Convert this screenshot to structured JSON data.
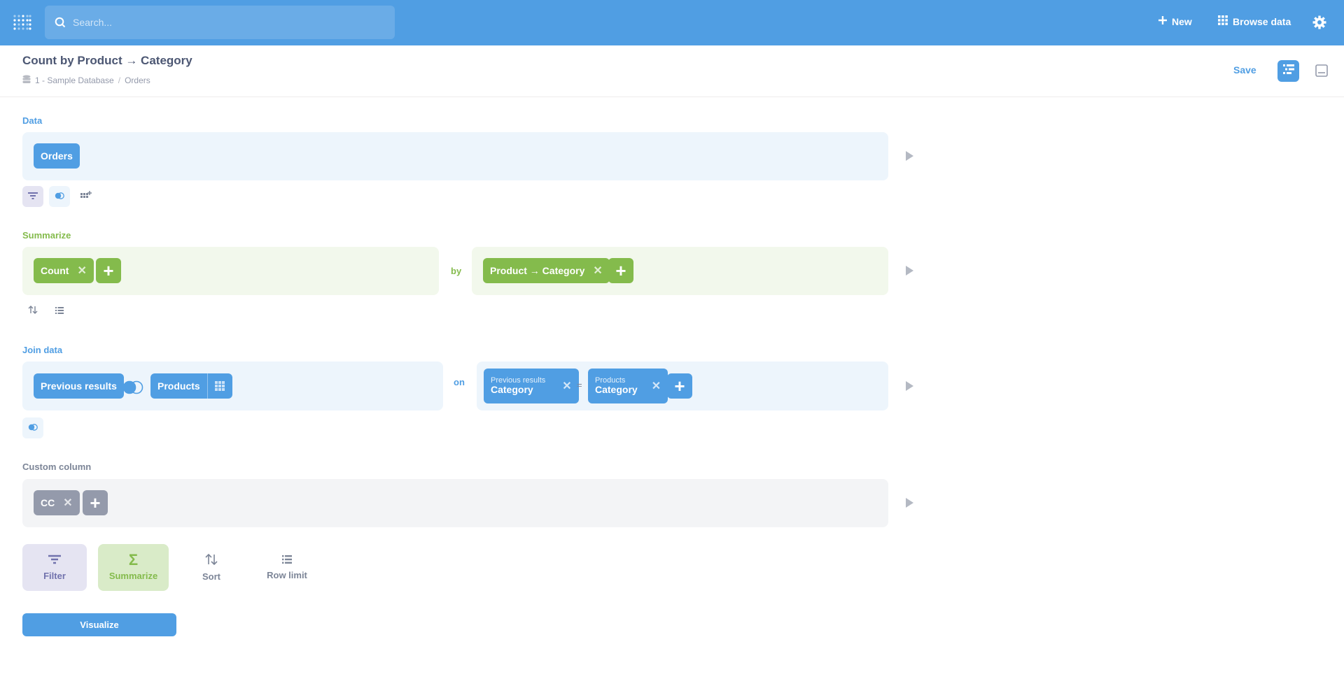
{
  "nav": {
    "search_placeholder": "Search...",
    "new_label": "New",
    "browse_label": "Browse data"
  },
  "header": {
    "title": "Count by Product → Category",
    "database": "1 - Sample Database",
    "table": "Orders",
    "crumb_sep": "/",
    "save_label": "Save"
  },
  "data_step": {
    "label": "Data",
    "table": "Orders"
  },
  "summarize_step": {
    "label": "Summarize",
    "metric": "Count",
    "by_label": "by",
    "breakout": "Product → Category"
  },
  "join_step": {
    "label": "Join data",
    "left_table": "Previous results",
    "right_table": "Products",
    "on_label": "on",
    "left_column_source": "Previous results",
    "left_column": "Category",
    "operator": "=",
    "right_column_source": "Products",
    "right_column": "Category"
  },
  "custom_column_step": {
    "label": "Custom column",
    "column": "CC"
  },
  "actions": {
    "filter": "Filter",
    "summarize": "Summarize",
    "sort": "Sort",
    "row_limit": "Row limit"
  },
  "visualize_label": "Visualize",
  "colors": {
    "brand": "#509ee3",
    "summarize": "#84bb4c",
    "filter": "#7172ad",
    "custom": "#949aab"
  }
}
